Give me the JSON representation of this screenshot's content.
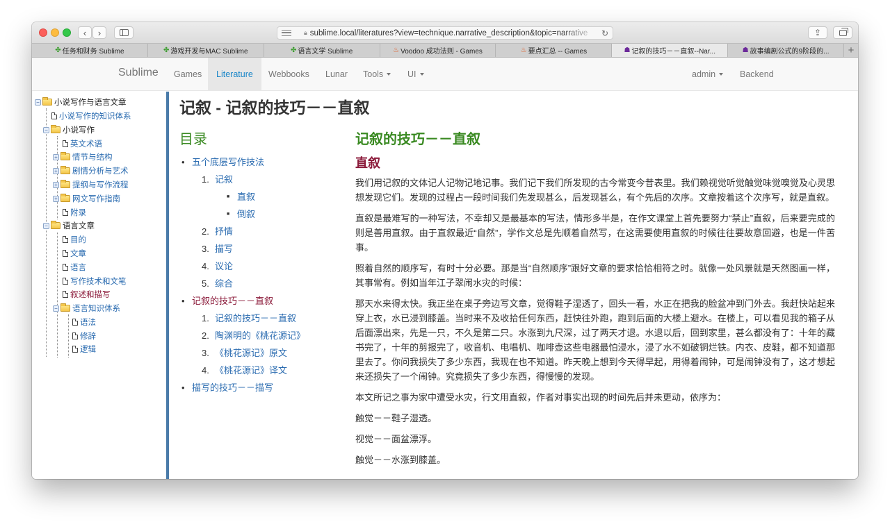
{
  "browser": {
    "url": "sublime.local/literatures?view=technique.narrative_description&topic=narrative",
    "tabs": [
      {
        "icon": "clover",
        "label": "任务和财务 Sublime"
      },
      {
        "icon": "clover",
        "label": "游戏开发与MAC Sublime"
      },
      {
        "icon": "clover",
        "label": "语言文学 Sublime"
      },
      {
        "icon": "flame",
        "label": "Voodoo 成功法则 - Games"
      },
      {
        "icon": "flame",
        "label": "要点汇总 -- Games"
      },
      {
        "icon": "grim",
        "label": "记叙的技巧－－直叙--Nar..."
      },
      {
        "icon": "grim",
        "label": "故事编剧公式的9阶段的..."
      }
    ],
    "active_tab": 5
  },
  "nav": {
    "brand": "Sublime",
    "items": [
      "Games",
      "Literature",
      "Webbooks",
      "Lunar",
      "Tools",
      "UI"
    ],
    "right": [
      "admin",
      "Backend"
    ]
  },
  "sidebar": {
    "root": "小说写作与语言文章",
    "n1": "小说写作的知识体系",
    "n2": "小说写作",
    "n2a": "英文术语",
    "n2b": "情节与结构",
    "n2c": "剧情分析与艺术",
    "n2d": "提纲与写作流程",
    "n2e": "网文写作指南",
    "n2f": "附录",
    "n3": "语言文章",
    "n3a": "目的",
    "n3b": "文章",
    "n3c": "语言",
    "n3d": "写作技术和文笔",
    "n3e": "叙述和描写",
    "n3f": "语言知识体系",
    "n3f1": "语法",
    "n3f2": "修辞",
    "n3f3": "逻辑"
  },
  "page": {
    "title": "记叙 - 记叙的技巧－－直叙"
  },
  "toc": {
    "heading": "目录",
    "s1": "五个底层写作技法",
    "s1_1": "记叙",
    "s1_1a": "直叙",
    "s1_1b": "倒叙",
    "s1_2": "抒情",
    "s1_3": "描写",
    "s1_4": "议论",
    "s1_5": "综合",
    "s2": "记叙的技巧－－直叙",
    "s2_1": "记叙的技巧－－直叙",
    "s2_2": "陶渊明的《桃花源记》",
    "s2_3": "《桃花源记》原文",
    "s2_4": "《桃花源记》译文",
    "s3": "描写的技巧－－描写"
  },
  "article": {
    "h2": "记叙的技巧－－直叙",
    "h3": "直叙",
    "p1": "我们用记叙的文体记人记物记地记事。我们记下我们所发现的古今常变今昔表里。我们赖视觉听觉触觉味觉嗅觉及心灵思想发现它们。发现的过程占一段时间我们先发现甚么，后发现甚么，有个先后的次序。文章按着这个次序写，就是直叙。",
    "p2": "直叙是最难写的一种写法，不幸却又是最基本的写法，情形多半是，在作文课堂上首先要努力“禁止”直叙，后来要完成的则是善用直叙。由于直叙最近“自然”，学作文总是先顺着自然写，在这需要使用直叙的时候往往要故意回避，也是一件苦事。",
    "p3": "照着自然的顺序写，有时十分必要。那是当“自然顺序”跟好文章的要求恰恰相符之时。就像一处风景就是天然图画一样，其事常有。例如当年江子翠闹水灾的时候：",
    "p4": "那天水来得太快。我正坐在桌子旁边写文章，觉得鞋子湿透了，回头一看，水正在把我的脸盆冲到门外去。我赶快站起来穿上衣，水已浸到膝盖。当时来不及收拾任何东西，赶快往外跑，跑到后面的大楼上避水。在楼上，可以看见我的箱子从后面漂出来，先是一只，不久是第二只。水涨到九尺深，过了两天才退。水退以后，回到家里，甚么都没有了：十年的藏书完了，十年的剪报完了，收音机、电唱机、咖啡壶这些电器最怕浸水，浸了水不如破铜烂铁。内衣、皮鞋，都不知道那里去了。你问我损失了多少东西，我现在也不知道。昨天晚上想到今天得早起，用得着闹钟，可是闹钟没有了，这才想起来还损失了一个闹钟。究竟损失了多少东西，得慢慢的发现。",
    "p5": "本文所记之事为家中遭受水灾，行文用直叙，作者对事实出现的时间先后并未更动，依序为：",
    "p6": "触觉－－鞋子湿透。",
    "p7": "视觉－－面盆漂浮。",
    "p8": "触觉－－水涨到膝盖。"
  }
}
